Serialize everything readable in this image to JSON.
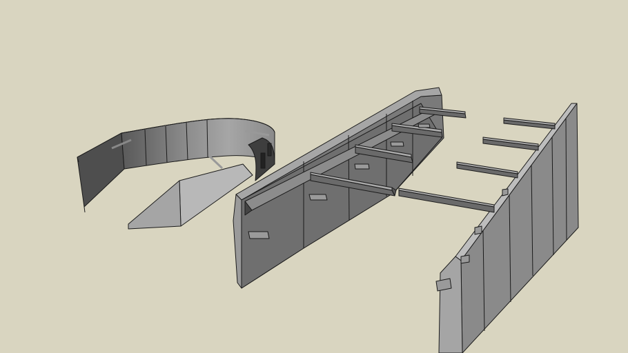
{
  "scene": {
    "background": "#d9d5c0",
    "edge_color": "#1a1a1a",
    "colors": {
      "face_light": "#9b9b9b",
      "face_mid": "#7d7d7d",
      "face_dark": "#5a5a5a",
      "face_darker": "#4a4a4a",
      "face_top": "#bcbcbc",
      "beam_top": "#a8a8a8",
      "beam_side": "#6e6e6e"
    },
    "objects": [
      {
        "name": "curved-wall-segment"
      },
      {
        "name": "boat-hull-formwork"
      },
      {
        "name": "side-panel-with-beams"
      }
    ]
  }
}
